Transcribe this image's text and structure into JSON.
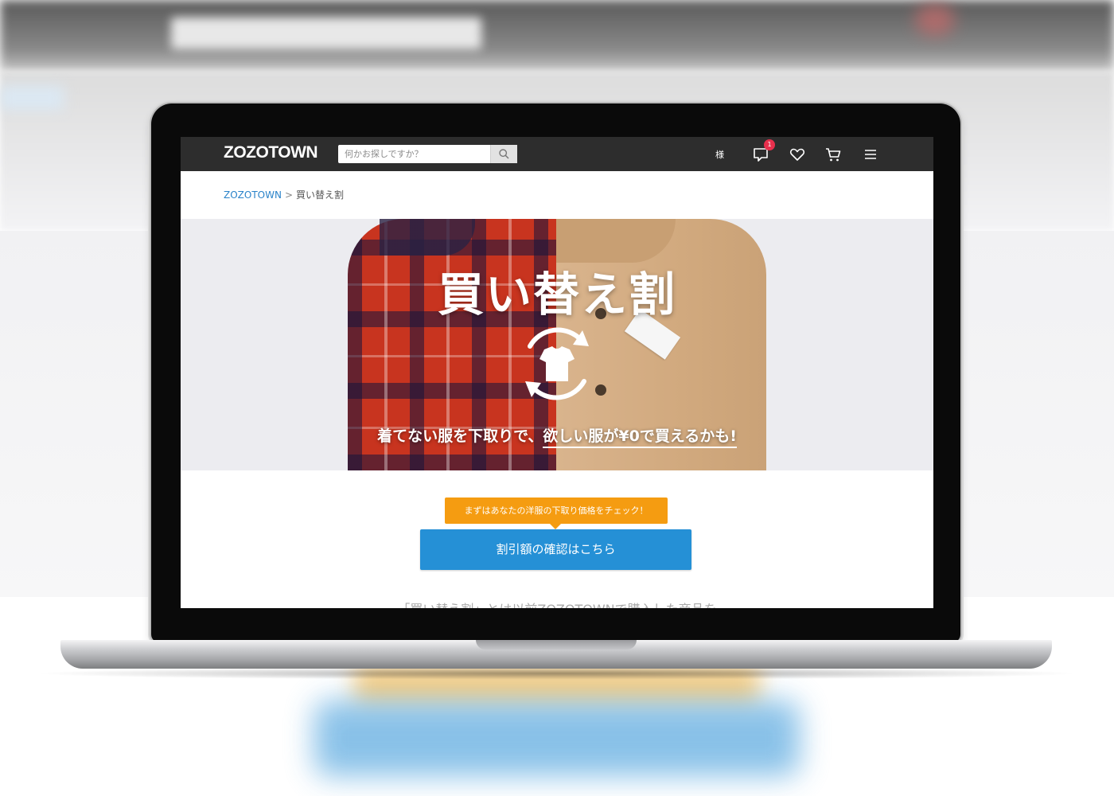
{
  "header": {
    "logo": "ZOZOTOWN",
    "search_placeholder": "何かお探しですか？",
    "user_suffix": "様",
    "notification_count": "1",
    "icons": [
      "search-icon",
      "message-icon",
      "heart-icon",
      "cart-icon",
      "menu-icon"
    ]
  },
  "breadcrumb": {
    "home": "ZOZOTOWN",
    "separator": ">",
    "current": "買い替え割"
  },
  "hero": {
    "title": "買い替え割",
    "subtitle_lead": "着てない服を下取りで、",
    "subtitle_underlined": "欲しい服が¥0で買えるかも!"
  },
  "cta": {
    "tooltip": "まずはあなたの洋服の下取り価格をチェック！",
    "button_label": "割引額の確認はこちら"
  },
  "body_text_cut": "「買い替え割」とは以前ZOZOTOWNで購入した商品を",
  "colors": {
    "header_bg": "#2d2d2d",
    "link": "#2a83c9",
    "cta_orange": "#f59c11",
    "cta_blue": "#2590d6",
    "badge": "#e8304d"
  }
}
